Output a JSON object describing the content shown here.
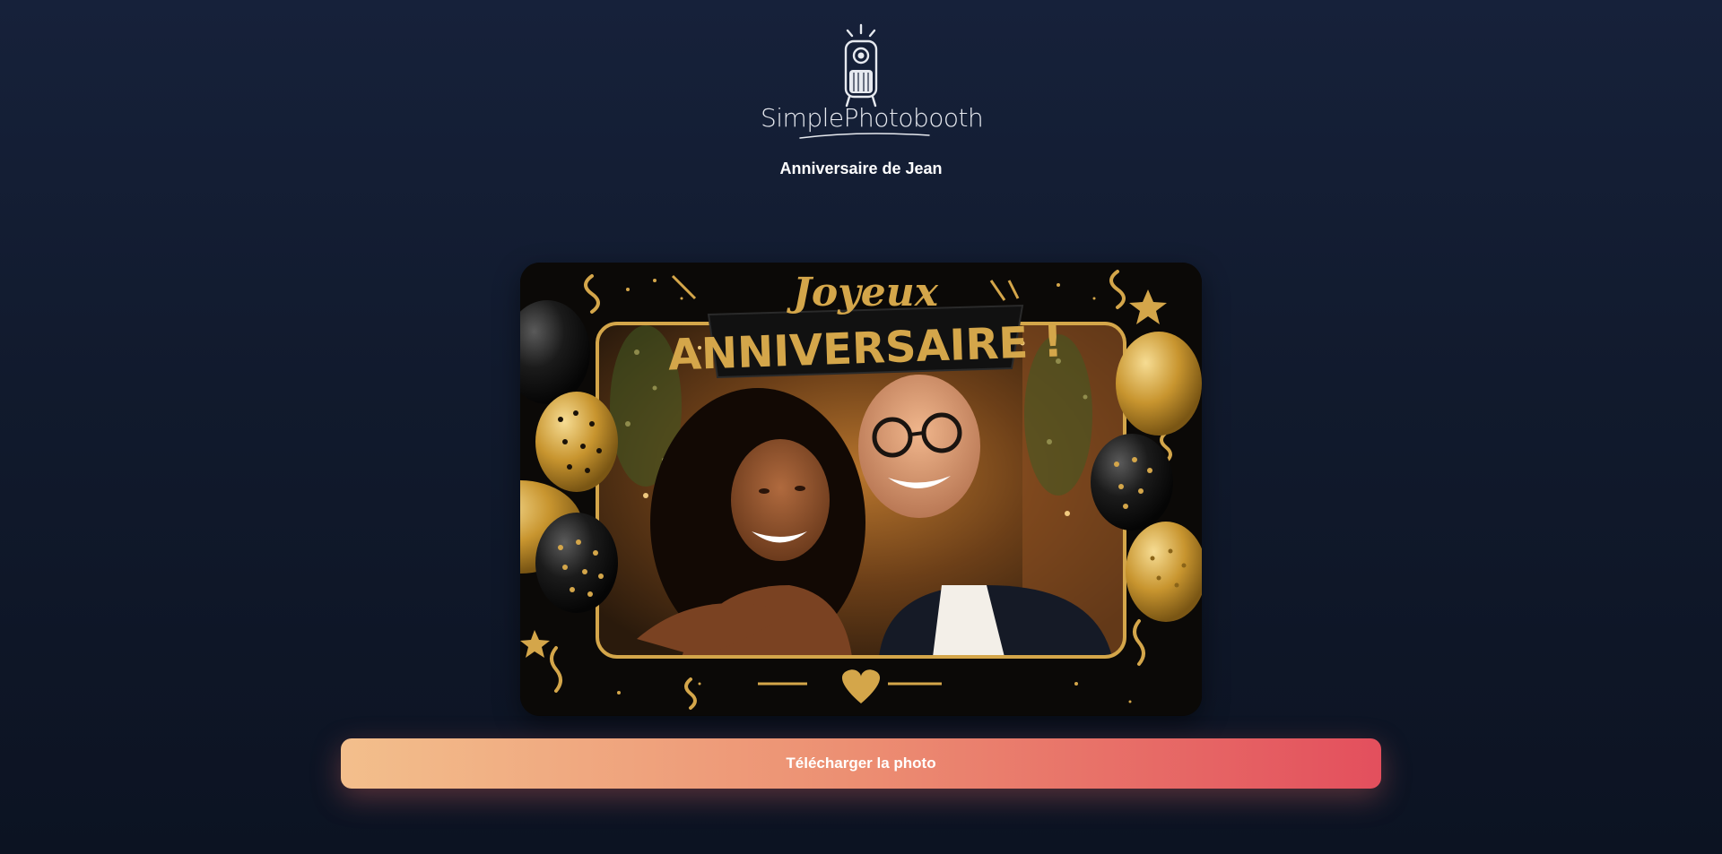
{
  "brand": {
    "name": "SimplePhotobooth",
    "logo_icon": "photobooth-camera-icon"
  },
  "event": {
    "title": "Anniversaire de Jean"
  },
  "photo": {
    "frame_line1": "Joyeux",
    "frame_line2": "ANNIVERSAIRE !"
  },
  "actions": {
    "download_label": "Télécharger la photo"
  },
  "colors": {
    "accent_start": "#f3bf8c",
    "accent_end": "#e34f5d",
    "gold": "#d4a64a"
  }
}
